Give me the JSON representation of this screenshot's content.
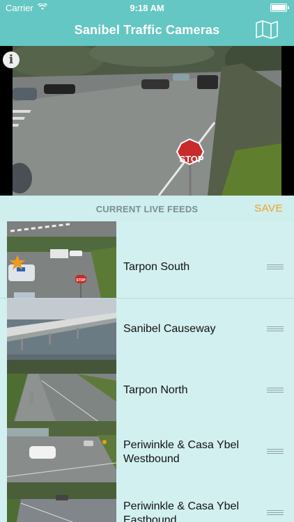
{
  "status_bar": {
    "carrier": "Carrier",
    "time": "9:18 AM"
  },
  "nav": {
    "title": "Sanibel Traffic Cameras",
    "map_icon": "map-icon"
  },
  "main_camera": {
    "info_label": "i",
    "sign_text": "STOP"
  },
  "feeds": {
    "header": "CURRENT LIVE FEEDS",
    "save_label": "SAVE",
    "items": [
      {
        "label": "",
        "favorite": false
      },
      {
        "label": "Tarpon South",
        "favorite": true,
        "sign_text": "STOP"
      },
      {
        "label": "Sanibel Causeway",
        "favorite": false
      },
      {
        "label": "Tarpon North",
        "favorite": false
      },
      {
        "label": "Periwinkle & Casa Ybel Westbound",
        "favorite": false
      },
      {
        "label": "Periwinkle & Casa Ybel Eastbound",
        "favorite": false
      }
    ]
  },
  "colors": {
    "nav_bar": "#64c7c3",
    "list_bg": "#cfeeee",
    "save": "#f0a020",
    "star": "#f29a1c"
  }
}
